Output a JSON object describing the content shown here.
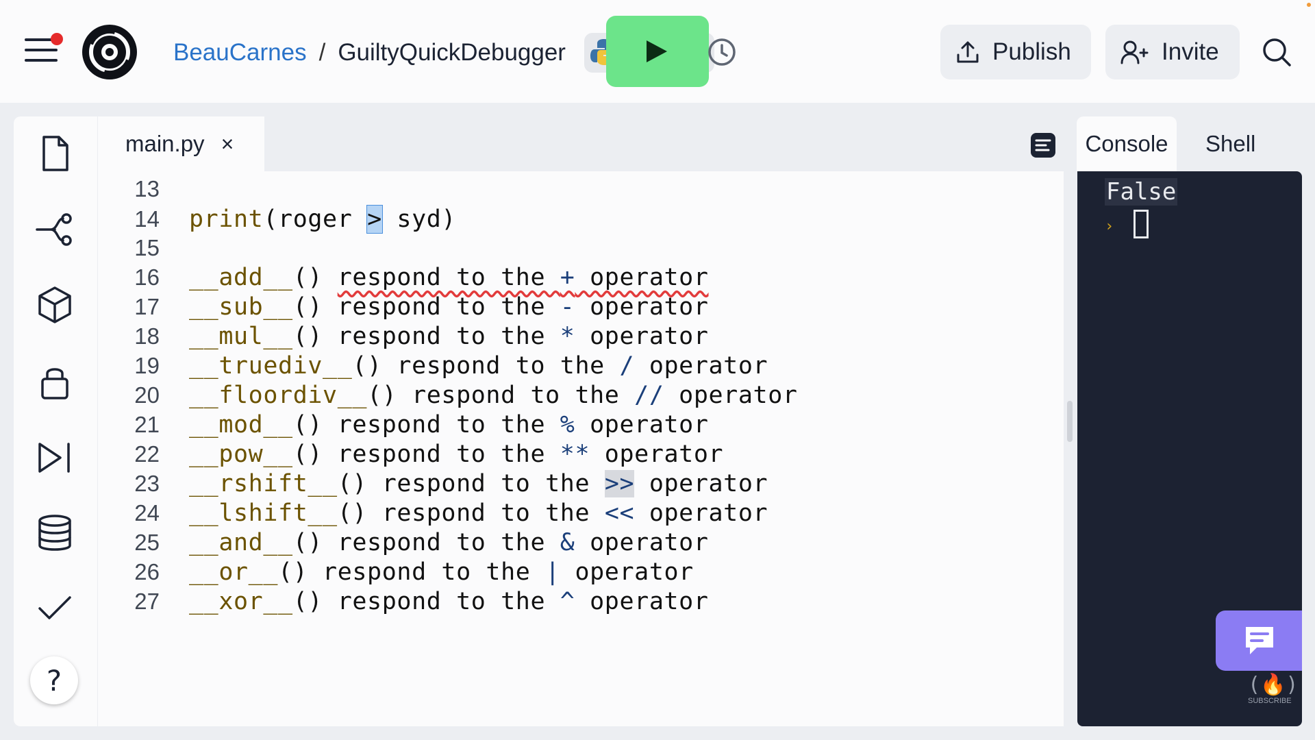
{
  "header": {
    "breadcrumb_user": "BeauCarnes",
    "breadcrumb_sep": "/",
    "repl_name": "GuiltyQuickDebugger",
    "publish_label": "Publish",
    "invite_label": "Invite",
    "icons": [
      "menu-icon",
      "replit-logo",
      "python-icon",
      "play-icon",
      "history-icon",
      "upload-icon",
      "add-user-icon",
      "search-icon"
    ]
  },
  "sidebar": {
    "icons": [
      "files-icon",
      "git-icon",
      "packages-icon",
      "secrets-icon",
      "debugger-icon",
      "database-icon",
      "tests-icon"
    ],
    "help_label": "?"
  },
  "editor": {
    "tab_name": "main.py",
    "tab_close": "×",
    "lines": [
      {
        "n": "13",
        "t": ""
      },
      {
        "n": "14",
        "t": "print(roger > syd)"
      },
      {
        "n": "15",
        "t": ""
      },
      {
        "n": "16",
        "t": "__add__() respond to the + operator"
      },
      {
        "n": "17",
        "t": "__sub__() respond to the - operator"
      },
      {
        "n": "18",
        "t": "__mul__() respond to the * operator"
      },
      {
        "n": "19",
        "t": "__truediv__() respond to the / operator"
      },
      {
        "n": "20",
        "t": "__floordiv__() respond to the // operator"
      },
      {
        "n": "21",
        "t": "__mod__() respond to the % operator"
      },
      {
        "n": "22",
        "t": "__pow__() respond to the ** operator"
      },
      {
        "n": "23",
        "t": "__rshift__() respond to the >> operator"
      },
      {
        "n": "24",
        "t": "__lshift__() respond to the << operator"
      },
      {
        "n": "25",
        "t": "__and__() respond to the & operator"
      },
      {
        "n": "26",
        "t": "__or__() respond to the | operator"
      },
      {
        "n": "27",
        "t": "__xor__() respond to the ^ operator"
      }
    ]
  },
  "right_panel": {
    "tab_console": "Console",
    "tab_shell": "Shell",
    "output": "False",
    "prompt": "›",
    "subscribe_logo": "(🔥)",
    "subscribe_label": "SUBSCRIBE"
  },
  "colors": {
    "run_button": "#6ce48a",
    "link": "#2a73c9",
    "console_bg": "#1c2232",
    "chat_button": "#8b7cf3",
    "notification_dot": "#e52b2b"
  }
}
